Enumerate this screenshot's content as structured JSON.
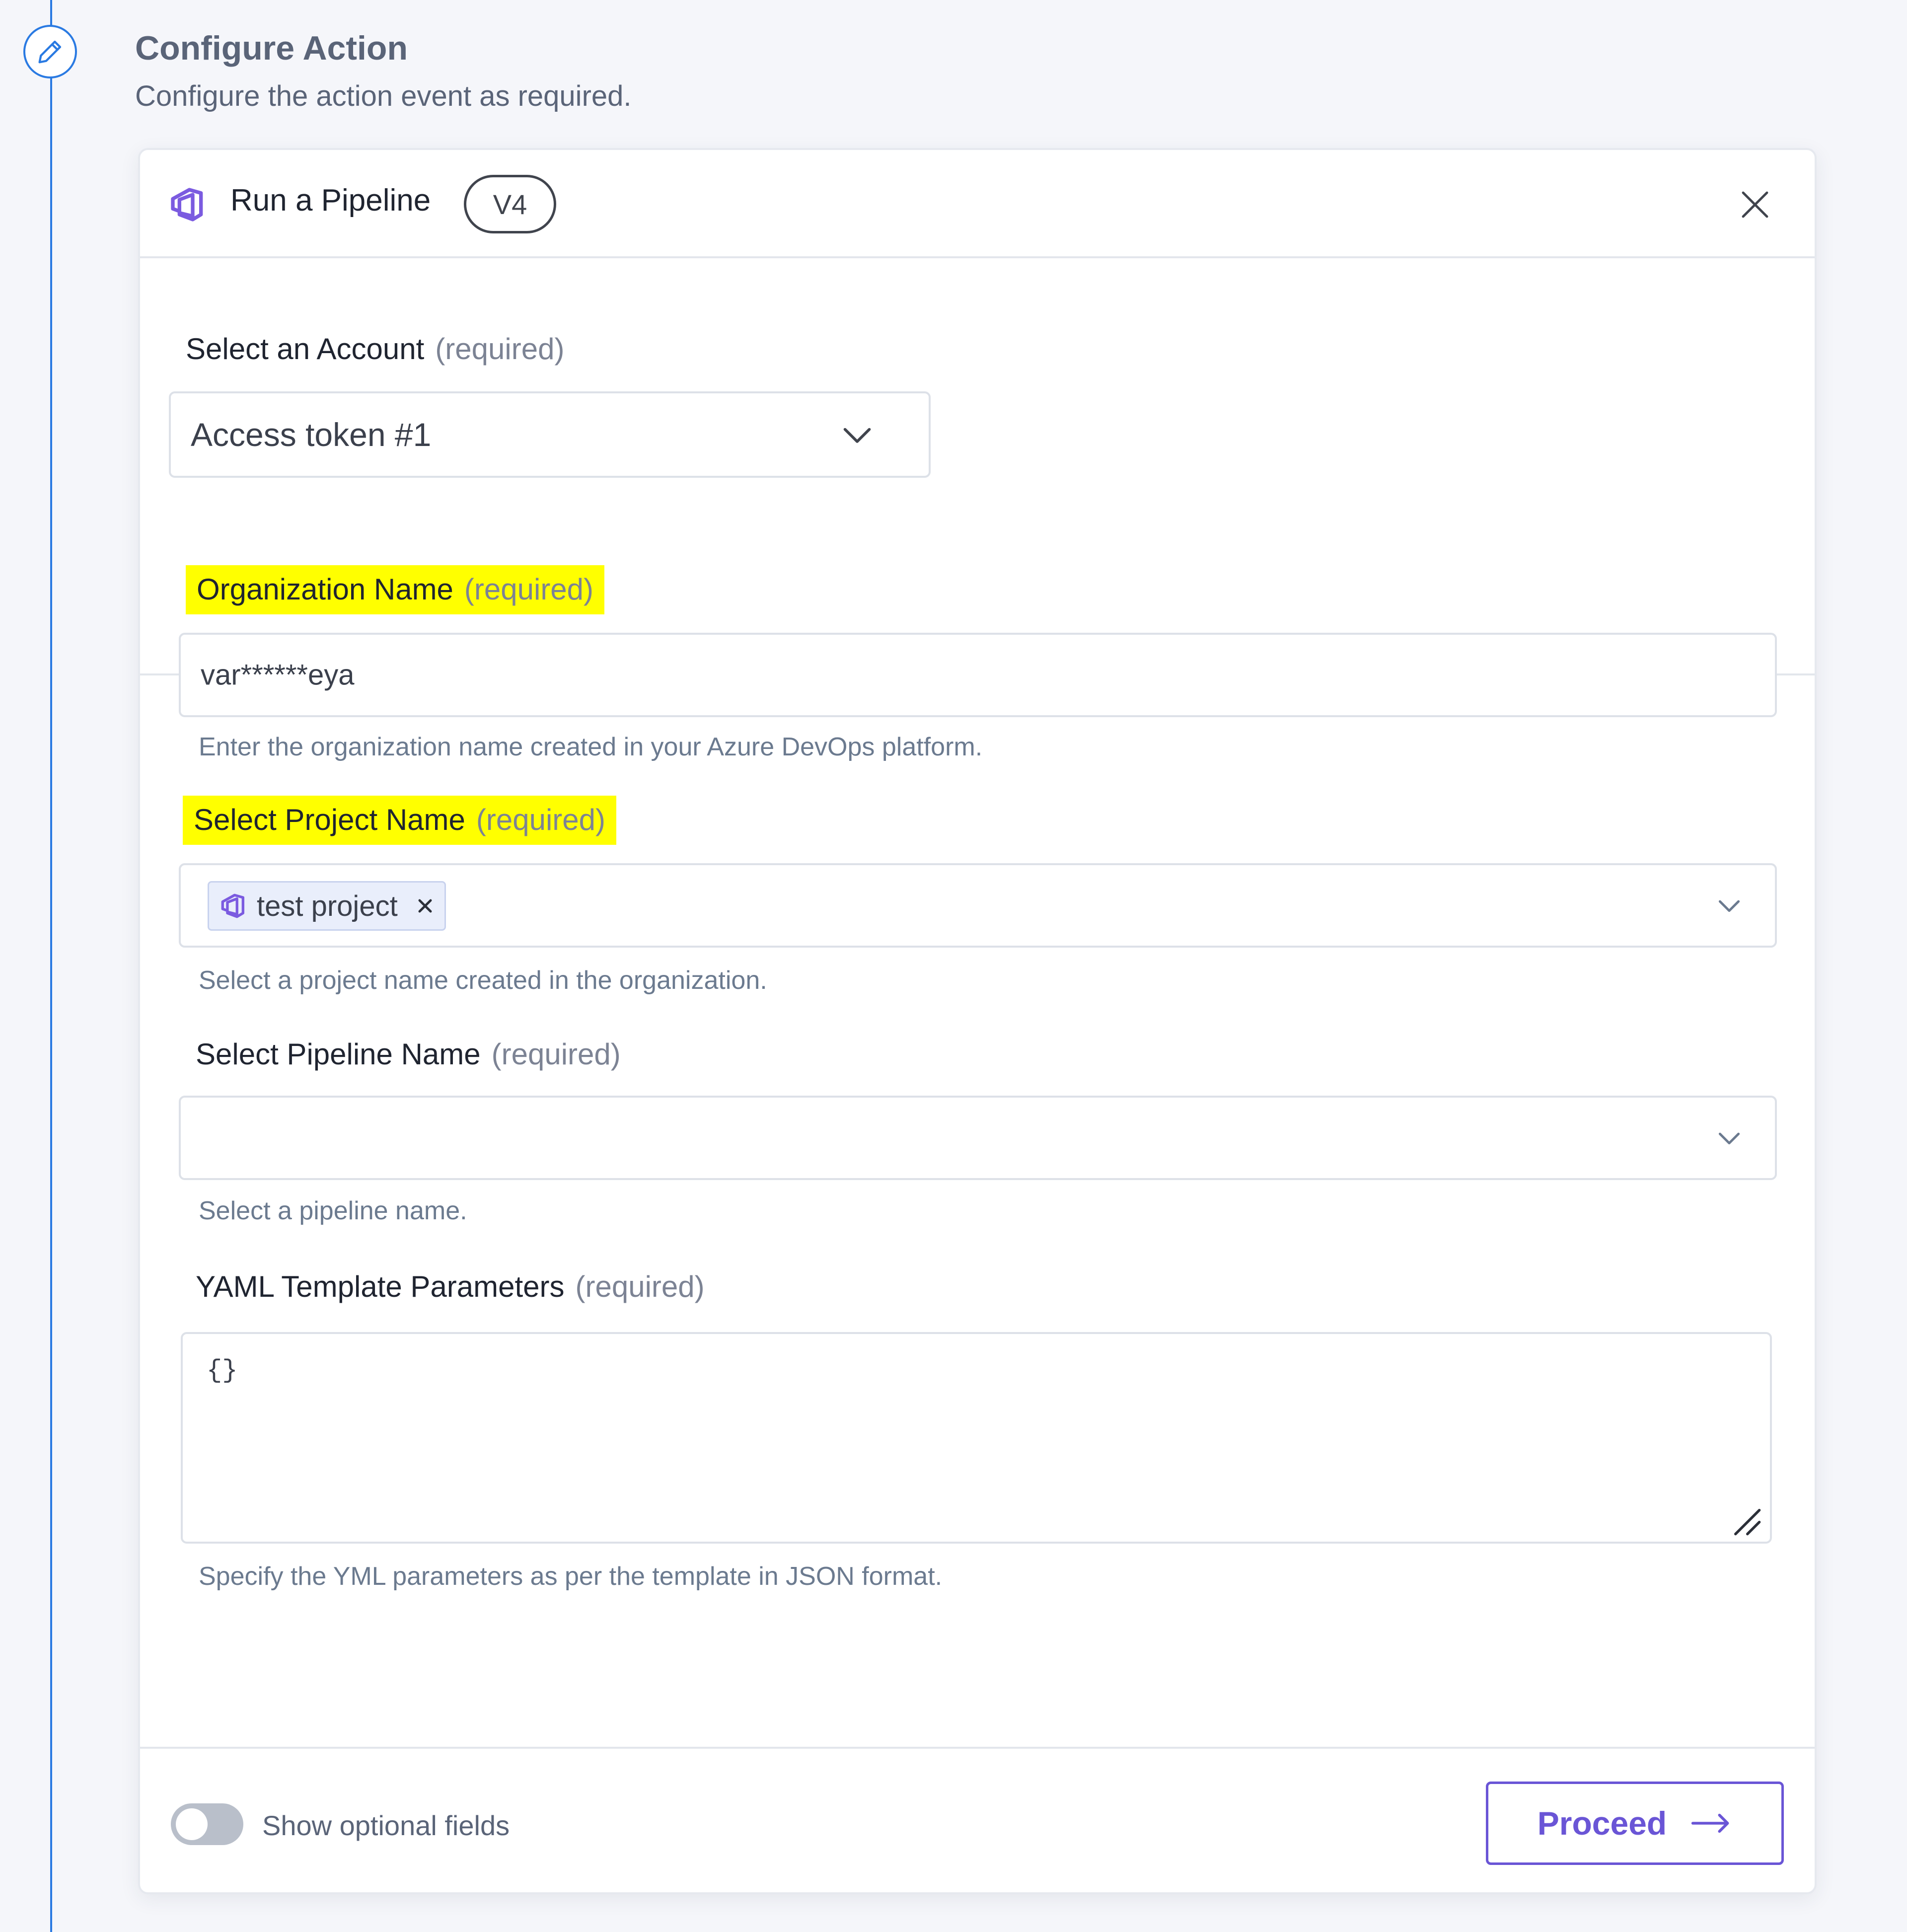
{
  "section": {
    "title": "Configure Action",
    "subtitle": "Configure the action event as required.",
    "icon": "pencil-icon",
    "accent_color": "#2a7ae2"
  },
  "card": {
    "app_icon": "azure-devops-icon",
    "title": "Run a Pipeline",
    "version": "V4",
    "close_icon": "close-icon"
  },
  "account": {
    "label": "Select an Account",
    "required": "(required)",
    "value": "Access token #1"
  },
  "fields": {
    "organization": {
      "label": "Organization Name",
      "required": "(required)",
      "value": "var******eya",
      "hint": "Enter the organization name created in your Azure DevOps platform."
    },
    "project": {
      "label": "Select Project Name",
      "required": "(required)",
      "chip_label": "test project",
      "hint": "Select a project name created in the organization."
    },
    "pipeline": {
      "label": "Select Pipeline Name",
      "required": "(required)",
      "value": "",
      "hint": "Select a pipeline name."
    },
    "yaml": {
      "label": "YAML Template Parameters",
      "required": "(required)",
      "value": "{}",
      "hint": "Specify the YML parameters as per the template in JSON format."
    }
  },
  "footer": {
    "toggle_label": "Show optional fields",
    "toggle_on": false,
    "proceed_label": "Proceed",
    "accent_color": "#6a55d6"
  },
  "highlight_color": "#ffff00"
}
